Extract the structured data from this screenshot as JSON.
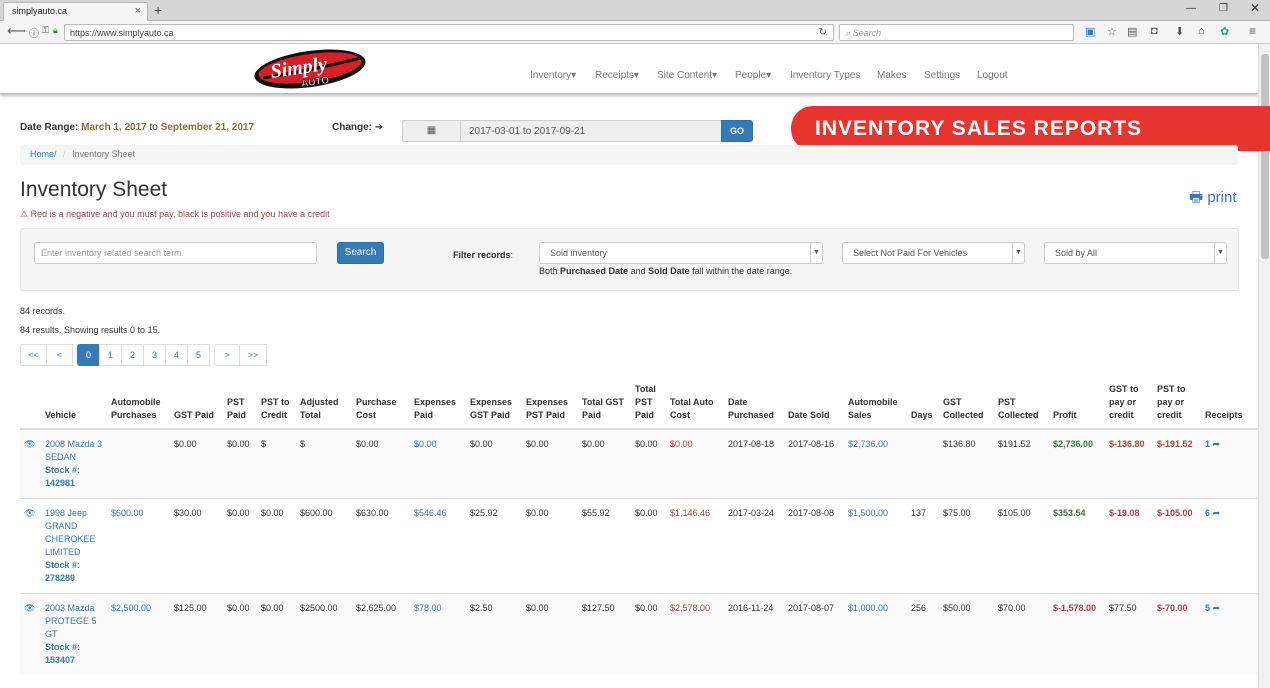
{
  "browser": {
    "tab_title": "simplyauto.ca",
    "url": "https://www.simplyauto.ca",
    "search_placeholder": "Search"
  },
  "site": {
    "logo_text_top": "Simply",
    "logo_text_bottom": "AUTO",
    "menu": [
      "Inventory▾",
      "Receipts▾",
      "Site Content▾",
      "People▾",
      "Inventory Types",
      "Makes",
      "Settings",
      "Logout"
    ]
  },
  "date_range": {
    "label": "Date Range:",
    "start": "March 1, 2017",
    "to": "to",
    "end": "September 21, 2017",
    "change_label": "Change:",
    "picker_value": "2017-03-01 to 2017-09-21",
    "go_label": "GO"
  },
  "banner_text": "INVENTORY SALES REPORTS",
  "breadcrumb": {
    "home": "Home/",
    "current": "Inventory Sheet"
  },
  "page_title": "Inventory Sheet",
  "warning_text": "Red is a negative and you must pay, black is positive and you have a credit",
  "print_label": "print",
  "filters": {
    "search_placeholder": "Enter inventory related search term",
    "search_button": "Search",
    "filter_label": "Filter records",
    "inventory_select": "Sold inventory",
    "paid_select": "Select Not Paid For Vehicles",
    "sold_by_select": "Sold by All",
    "note_prefix": "Both",
    "note_b1": "Purchased Date",
    "note_and": "and",
    "note_b2": "Sold Date",
    "note_suffix": "fall within the date range."
  },
  "records_text": "84 records.",
  "results_text": "84 results. Showing results 0 to 15.",
  "pagination": [
    "<<",
    "<",
    "0",
    "1",
    "2",
    "3",
    "4",
    "5",
    ">",
    ">>"
  ],
  "table": {
    "headers": [
      "",
      "Vehicle",
      "Automobile Purchases",
      "GST Paid",
      "PST Paid",
      "PST to Credit",
      "Adjusted Total",
      "Purchase Cost",
      "Expenses Paid",
      "Expenses GST Paid",
      "Expenses PST Paid",
      "Total GST Paid",
      "Total PST Paid",
      "Total Auto Cost",
      "Date Purchased",
      "Date Sold",
      "Automobile Sales",
      "Days",
      "GST Collected",
      "PST Collected",
      "Profit",
      "GST to pay or credit",
      "PST to pay or credit",
      "Receipts"
    ],
    "rows": [
      {
        "vehicle": "2008 Mazda 3 SEDAN",
        "stock": "Stock #: 142981",
        "auto_purchases": "",
        "gst_paid": "$0.00",
        "pst_paid": "$0.00",
        "pst_credit": "$",
        "adjusted_total": "$",
        "purchase_cost": "$0.00",
        "expenses_paid": "$0.00",
        "exp_gst": "$0.00",
        "exp_pst": "$0.00",
        "total_gst": "$0.00",
        "total_pst": "$0.00",
        "total_auto_cost": "$0.00",
        "date_purchased": "2017-08-18",
        "date_sold": "2017-08-16",
        "auto_sales": "$2,736.00",
        "days": "",
        "gst_collected": "$136.80",
        "pst_collected": "$191.52",
        "profit": "$2,736.00",
        "gst_pay": "$-136.80",
        "pst_pay": "$-191.52",
        "receipts": "1"
      },
      {
        "vehicle": "1998 Jeep GRAND CHEROKEE LIMITED",
        "stock": "Stock #: 278289",
        "auto_purchases": "$600.00",
        "gst_paid": "$30.00",
        "pst_paid": "$0.00",
        "pst_credit": "$0.00",
        "adjusted_total": "$600.00",
        "purchase_cost": "$630.00",
        "expenses_paid": "$546.46",
        "exp_gst": "$25.92",
        "exp_pst": "$0.00",
        "total_gst": "$55.92",
        "total_pst": "$0.00",
        "total_auto_cost": "$1,146.46",
        "date_purchased": "2017-03-24",
        "date_sold": "2017-08-08",
        "auto_sales": "$1,500.00",
        "days": "137",
        "gst_collected": "$75.00",
        "pst_collected": "$105.00",
        "profit": "$353.54",
        "gst_pay": "$-19.08",
        "pst_pay": "$-105.00",
        "receipts": "6"
      },
      {
        "vehicle": "2003 Mazda PROTEGE 5 GT",
        "stock": "Stock #: 153407",
        "auto_purchases": "$2,500.00",
        "gst_paid": "$125.00",
        "pst_paid": "$0.00",
        "pst_credit": "$0.00",
        "adjusted_total": "$2500.00",
        "purchase_cost": "$2,625.00",
        "expenses_paid": "$78.00",
        "exp_gst": "$2.50",
        "exp_pst": "$0.00",
        "total_gst": "$127.50",
        "total_pst": "$0.00",
        "total_auto_cost": "$2,578.00",
        "date_purchased": "2016-11-24",
        "date_sold": "2017-08-07",
        "auto_sales": "$1,000.00",
        "days": "256",
        "gst_collected": "$50.00",
        "pst_collected": "$70.00",
        "profit": "$-1,578.00",
        "gst_pay": "$77.50",
        "pst_pay": "$-70.00",
        "receipts": "5"
      }
    ]
  },
  "colors": {
    "primary": "#337ab7",
    "banner": "#e8342f",
    "negative": "#a94442",
    "positive": "#3c763d"
  }
}
